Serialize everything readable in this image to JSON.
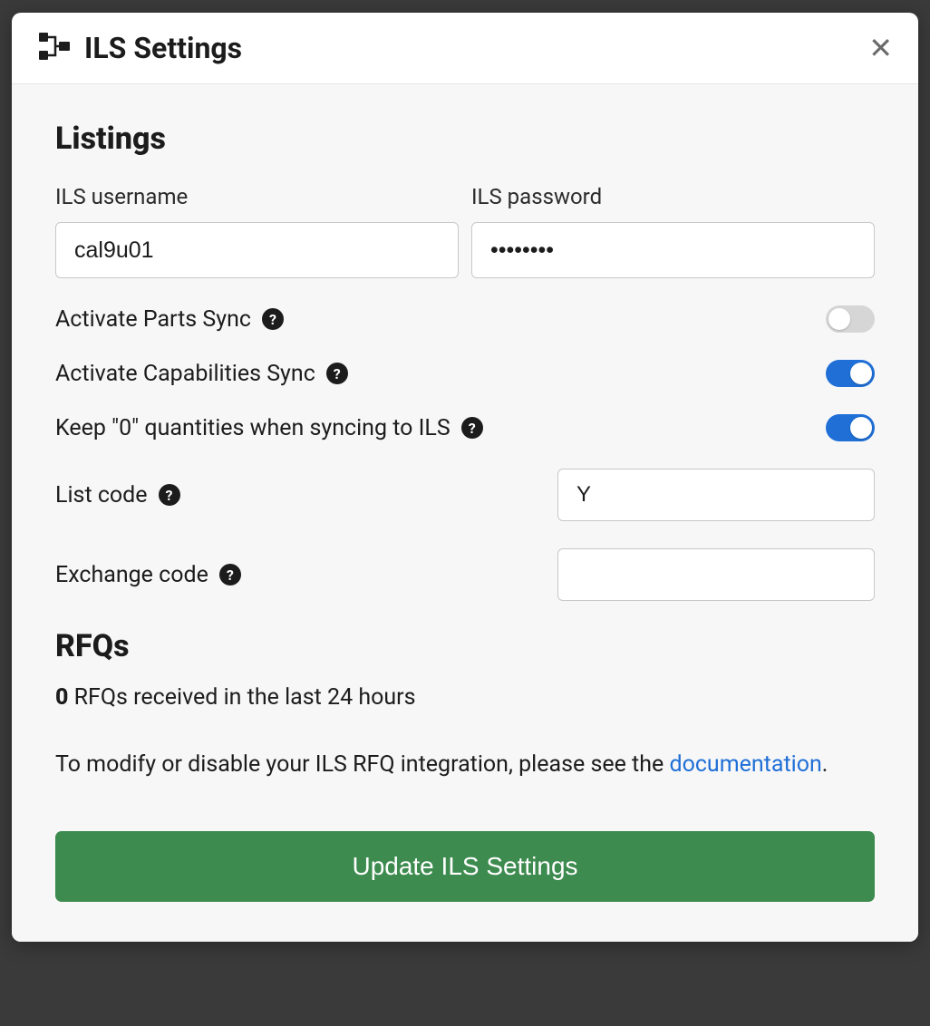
{
  "modal": {
    "title": "ILS Settings",
    "icon": "settings-icon"
  },
  "listings": {
    "title": "Listings",
    "username": {
      "label": "ILS username",
      "value": "cal9u01"
    },
    "password": {
      "label": "ILS password",
      "value": "••••••••"
    },
    "parts_sync": {
      "label": "Activate Parts Sync",
      "value": false
    },
    "capabilities_sync": {
      "label": "Activate Capabilities Sync",
      "value": true
    },
    "keep_zero": {
      "label": "Keep \"0\" quantities when syncing to ILS",
      "value": true
    },
    "list_code": {
      "label": "List code",
      "value": "Y"
    },
    "exchange_code": {
      "label": "Exchange code",
      "value": ""
    }
  },
  "rfqs": {
    "title": "RFQs",
    "count": "0",
    "count_suffix": " RFQs received in the last 24 hours",
    "note_prefix": "To modify or disable your ILS RFQ integration, please see the ",
    "documentation_link": "documentation",
    "note_suffix": "."
  },
  "submit": {
    "label": "Update ILS Settings"
  }
}
